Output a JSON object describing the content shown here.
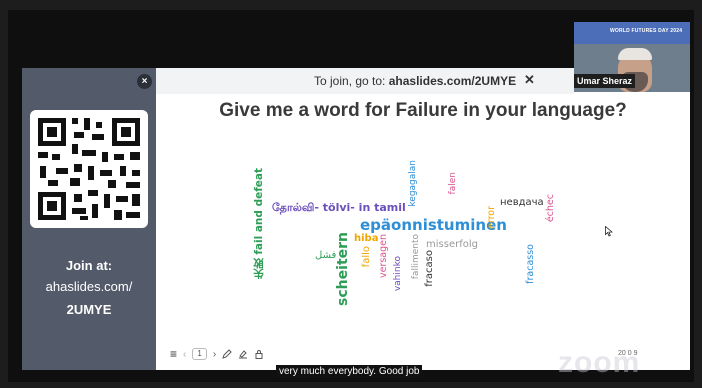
{
  "banner": {
    "prefix": "To join, go to: ",
    "url": "ahaslides.com/2UMYE",
    "close": "✕"
  },
  "panel": {
    "close": "×",
    "join_title": "Join at:",
    "join_url": "ahaslides.com/",
    "join_code": "2UMYE"
  },
  "question": "Give me a word for Failure in your language?",
  "words": [
    {
      "text": "失敗 fail and defeat",
      "color": "#2e9e57"
    },
    {
      "text": "தோல்வி- tölvi- in tamil",
      "color": "#6b4fbb"
    },
    {
      "text": "kegagalan",
      "color": "#2f8fd6"
    },
    {
      "text": "epäonnistuminen",
      "color": "#2f8fd6"
    },
    {
      "text": "hiba",
      "color": "#f0a500"
    },
    {
      "text": "فشل",
      "color": "#2e9e57"
    },
    {
      "text": "scheitern",
      "color": "#2e9e57"
    },
    {
      "text": "fallo",
      "color": "#f0a500"
    },
    {
      "text": "versagen",
      "color": "#d9558f"
    },
    {
      "text": "vahinko",
      "color": "#6b4fbb"
    },
    {
      "text": "fallimento",
      "color": "#999999"
    },
    {
      "text": "fracaso",
      "color": "#333333"
    },
    {
      "text": "misserfolg",
      "color": "#999999"
    },
    {
      "text": "falen",
      "color": "#d9558f"
    },
    {
      "text": "error",
      "color": "#f0a500"
    },
    {
      "text": "невдача",
      "color": "#333333"
    },
    {
      "text": "échec",
      "color": "#d9558f"
    },
    {
      "text": "fracasso",
      "color": "#2f8fd6"
    }
  ],
  "participant": {
    "name": "Umar Sheraz",
    "backdrop_text": "WORLD FUTURES DAY 2024"
  },
  "toolbar": {
    "menu": "≡",
    "prev": "‹",
    "page": "1",
    "next": "›"
  },
  "stats": "20  0  9",
  "caption": "very much everybody. Good job",
  "watermark": "zoom"
}
